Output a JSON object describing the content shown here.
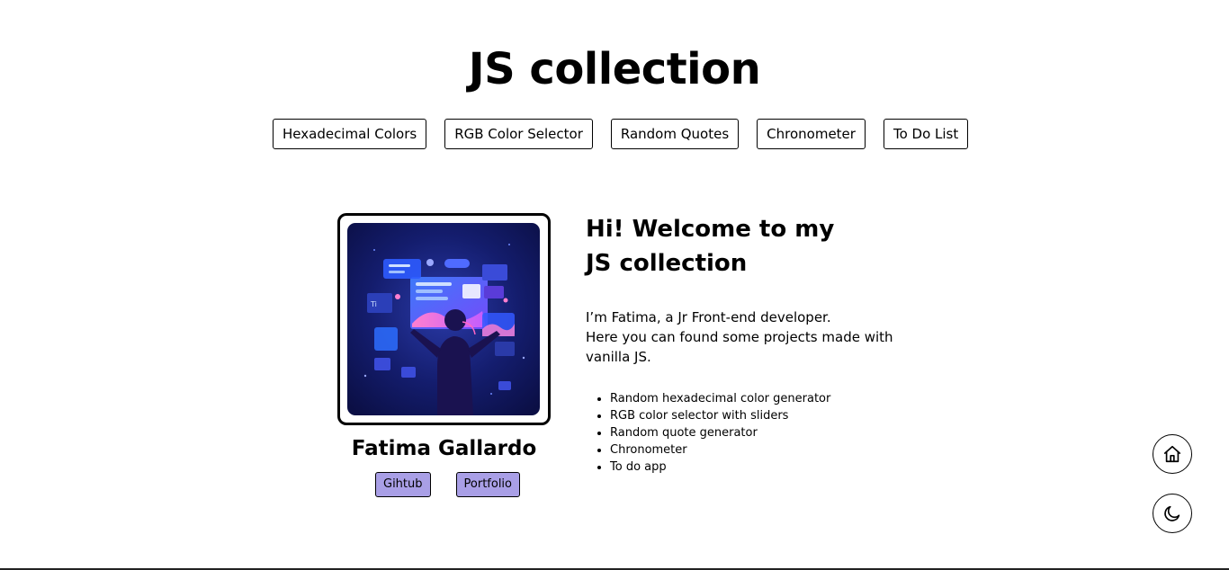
{
  "header": {
    "title": "JS collection"
  },
  "nav": {
    "items": [
      {
        "label": "Hexadecimal Colors"
      },
      {
        "label": "RGB Color Selector"
      },
      {
        "label": "Random Quotes"
      },
      {
        "label": "Chronometer"
      },
      {
        "label": "To Do List"
      }
    ]
  },
  "profile": {
    "name": "Fatima Gallardo",
    "links": [
      {
        "label": "Gihtub"
      },
      {
        "label": "Portfolio"
      }
    ],
    "link_color": "#a99fe6"
  },
  "intro": {
    "heading_line1": "Hi! Welcome to my",
    "heading_line2": "JS collection",
    "desc_line1": "I’m Fatima, a Jr Front-end developer.",
    "desc_line2": "Here you can found some projects made with",
    "desc_line3": "vanilla JS.",
    "features": [
      "Random hexadecimal color generator",
      "RGB color selector with sliders",
      "Random quote generator",
      "Chronometer",
      "To do app"
    ]
  },
  "floating": {
    "home_icon": "home-icon",
    "theme_icon": "moon-icon"
  }
}
